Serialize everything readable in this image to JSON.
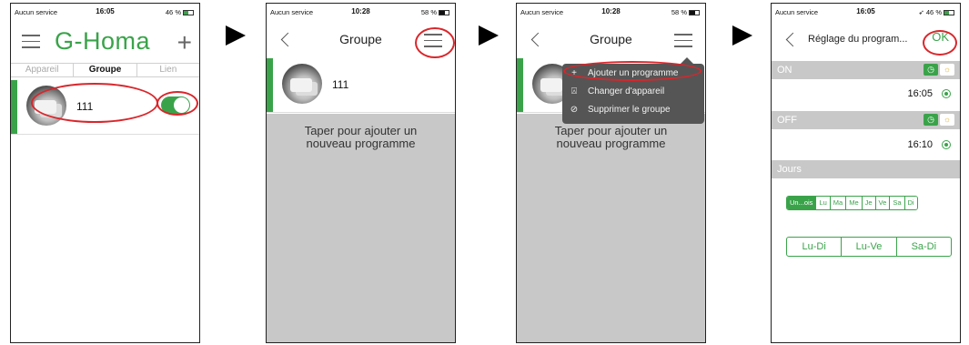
{
  "screens": [
    {
      "status": {
        "carrier": "Aucun service",
        "time": "16:05",
        "battery": "46 %"
      },
      "nav": {
        "title": "G-Homa"
      },
      "tabs": [
        "Appareil",
        "Groupe",
        "Lien"
      ],
      "row": {
        "label": "111"
      }
    },
    {
      "status": {
        "carrier": "Aucun service",
        "time": "10:28",
        "battery": "58 %"
      },
      "nav": {
        "title": "Groupe"
      },
      "row": {
        "label": "111"
      },
      "hint_line1": "Taper pour ajouter un",
      "hint_line2": "nouveau programme"
    },
    {
      "status": {
        "carrier": "Aucun service",
        "time": "10:28",
        "battery": "58 %"
      },
      "nav": {
        "title": "Groupe"
      },
      "row": {
        "label": "111"
      },
      "hint_line1": "Taper pour ajouter un",
      "hint_line2": "nouveau programme",
      "menu": [
        {
          "icon": "+",
          "label": "Ajouter un programme"
        },
        {
          "icon": "⍓",
          "label": "Changer d'appareil"
        },
        {
          "icon": "⊘",
          "label": "Supprimer le groupe"
        }
      ]
    },
    {
      "status": {
        "carrier": "Aucun service",
        "time": "16:05",
        "battery": "46 %"
      },
      "nav": {
        "title": "Réglage du program...",
        "ok": "OK"
      },
      "on": {
        "label": "ON",
        "time": "16:05"
      },
      "off": {
        "label": "OFF",
        "time": "16:10"
      },
      "jours": {
        "label": "Jours"
      },
      "days": [
        "Un...ois",
        "Lu",
        "Ma",
        "Me",
        "Je",
        "Ve",
        "Sa",
        "Di"
      ],
      "ranges": [
        "Lu-Di",
        "Lu-Ve",
        "Sa-Di"
      ]
    }
  ],
  "colors": {
    "accent": "#3aa34a",
    "highlight": "#d9262b",
    "menu_bg": "#555555"
  }
}
